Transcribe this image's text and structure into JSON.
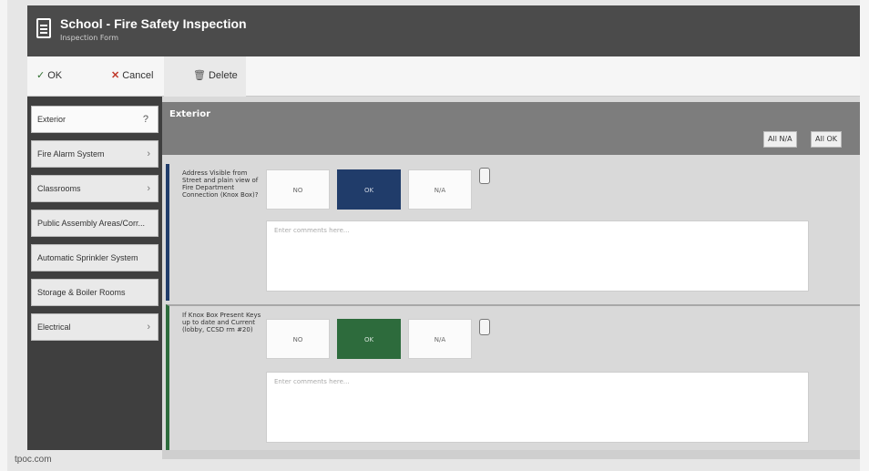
{
  "window": {
    "title": "School - Fire Safety Inspection",
    "subtitle": "Inspection Form"
  },
  "toolbar": {
    "ok_label": "OK",
    "cancel_label": "Cancel",
    "delete_label": "Delete"
  },
  "sidebar": {
    "items": [
      {
        "label": "Exterior",
        "badge": "?"
      },
      {
        "label": "Fire Alarm System"
      },
      {
        "label": "Classrooms"
      },
      {
        "label": "Public Assembly Areas/Corr..."
      },
      {
        "label": "Automatic Sprinkler System"
      },
      {
        "label": "Storage & Boiler Rooms"
      },
      {
        "label": "Electrical"
      }
    ]
  },
  "main": {
    "section_title": "Exterior",
    "all_na_label": "All N/A",
    "all_ok_label": "All OK",
    "questions": [
      {
        "text": "Address Visible from Street and plain view of Fire Department Connection (Knox Box)?",
        "options": [
          "NO",
          "OK",
          "N/A"
        ],
        "selected": "OK",
        "note_placeholder": "Enter comments here..."
      },
      {
        "text": "If Knox Box Present Keys up to date and Current (lobby, CCSD rm #20)",
        "options": [
          "NO",
          "OK",
          "N/A"
        ],
        "selected": "OK",
        "note_placeholder": "Enter comments here..."
      }
    ]
  },
  "footer": {
    "text": "tpoc.com"
  },
  "colors": {
    "title_bar": "#4b4b4b",
    "selected_blue": "#203c6a",
    "selected_green": "#2d6b3c",
    "sidebar_bg": "#3f3f3f"
  }
}
